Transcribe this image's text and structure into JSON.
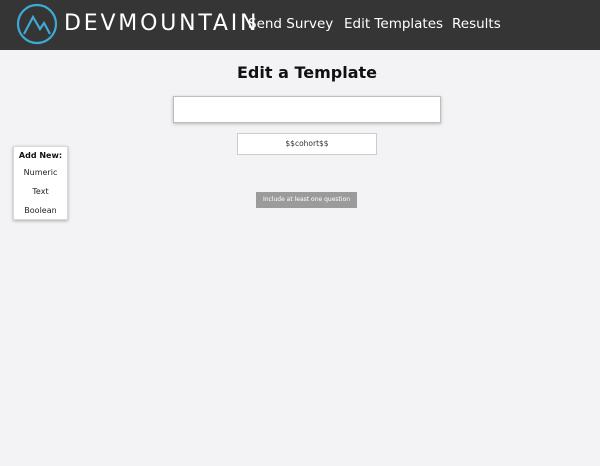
{
  "header": {
    "brand": "DEVMOUNTAIN",
    "logo_icon": "mountain-circle-icon",
    "nav": {
      "send_survey": "Send Survey",
      "edit_templates": "Edit Templates",
      "results": "Results"
    }
  },
  "main": {
    "title": "Edit a Template",
    "template_title_input": {
      "value": "",
      "placeholder": ""
    },
    "cohort_placeholder": "$$cohort$$",
    "warning": "Include at least one question"
  },
  "add_panel": {
    "heading": "Add New:",
    "items": [
      "Numeric",
      "Text",
      "Boolean"
    ]
  },
  "colors": {
    "header_bg": "#353535",
    "page_bg": "#f3f2f4",
    "logo_accent": "#3fa9d4",
    "warning_bg": "#9b9b9b"
  }
}
